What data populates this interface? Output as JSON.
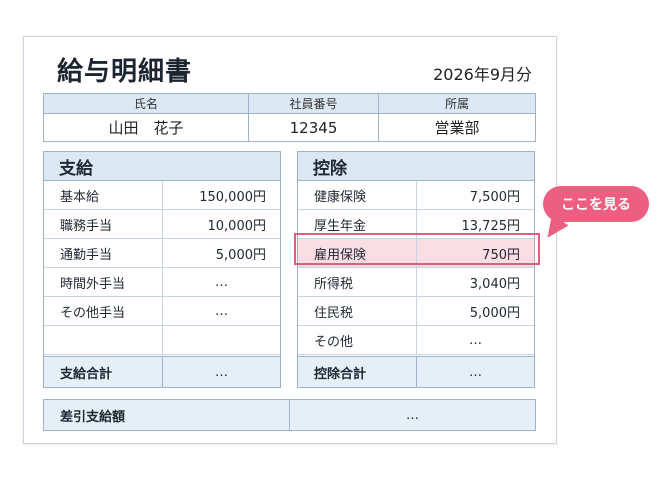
{
  "document": {
    "title": "給与明細書",
    "period": "2026年9月分"
  },
  "employee": {
    "headers": [
      "氏名",
      "社員番号",
      "所属"
    ],
    "values": [
      "山田　花子",
      "12345",
      "営業部"
    ]
  },
  "earnings": {
    "heading": "支給",
    "items": [
      {
        "label": "基本給",
        "amount": "150,000円"
      },
      {
        "label": "職務手当",
        "amount": "10,000円"
      },
      {
        "label": "通勤手当",
        "amount": "5,000円"
      },
      {
        "label": "時間外手当",
        "amount": "…"
      },
      {
        "label": "その他手当",
        "amount": "…"
      }
    ],
    "total_label": "支給合計",
    "total_amount": "…"
  },
  "deductions": {
    "heading": "控除",
    "items": [
      {
        "label": "健康保険",
        "amount": "7,500円"
      },
      {
        "label": "厚生年金",
        "amount": "13,725円"
      },
      {
        "label": "雇用保険",
        "amount": "750円"
      },
      {
        "label": "所得税",
        "amount": "3,040円"
      },
      {
        "label": "住民税",
        "amount": "5,000円"
      },
      {
        "label": "その他",
        "amount": "…"
      }
    ],
    "total_label": "控除合計",
    "total_amount": "…"
  },
  "net_pay": {
    "label": "差引支給額",
    "amount": "…"
  },
  "callout": {
    "text": "ここを見る"
  },
  "colors": {
    "header_bg": "#dbe7f3",
    "border": "#9fb3c8",
    "highlight": "#e55b7b",
    "callout": "#ec5f80"
  }
}
